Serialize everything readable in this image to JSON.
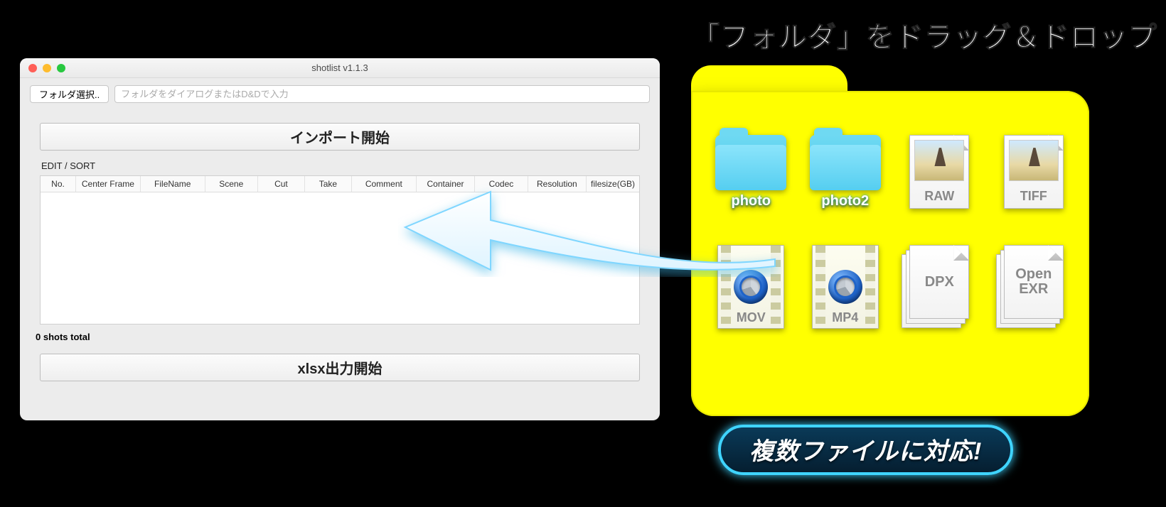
{
  "window": {
    "title": "shotlist v1.1.3",
    "folder_button": "フォルダ選択..",
    "folder_placeholder": "フォルダをダイアログまたはD&Dで入力",
    "import_button": "インポート開始",
    "section_label": "EDIT / SORT",
    "columns": [
      "No.",
      "Center Frame",
      "FileName",
      "Scene",
      "Cut",
      "Take",
      "Comment",
      "Container",
      "Codec",
      "Resolution",
      "filesize(GB)"
    ],
    "status": "0 shots total",
    "export_button": "xlsx出力開始"
  },
  "instruction": {
    "title": "「フォルダ」をドラッグ＆ドロップ",
    "badge": "複数ファイルに対応!",
    "items": [
      {
        "kind": "folder",
        "label": "photo"
      },
      {
        "kind": "folder",
        "label": "photo2"
      },
      {
        "kind": "image",
        "label": "RAW"
      },
      {
        "kind": "image",
        "label": "TIFF"
      },
      {
        "kind": "video",
        "label": "MOV"
      },
      {
        "kind": "video",
        "label": "MP4"
      },
      {
        "kind": "stack",
        "label": "DPX"
      },
      {
        "kind": "stack",
        "label": "Open\nEXR"
      }
    ]
  }
}
